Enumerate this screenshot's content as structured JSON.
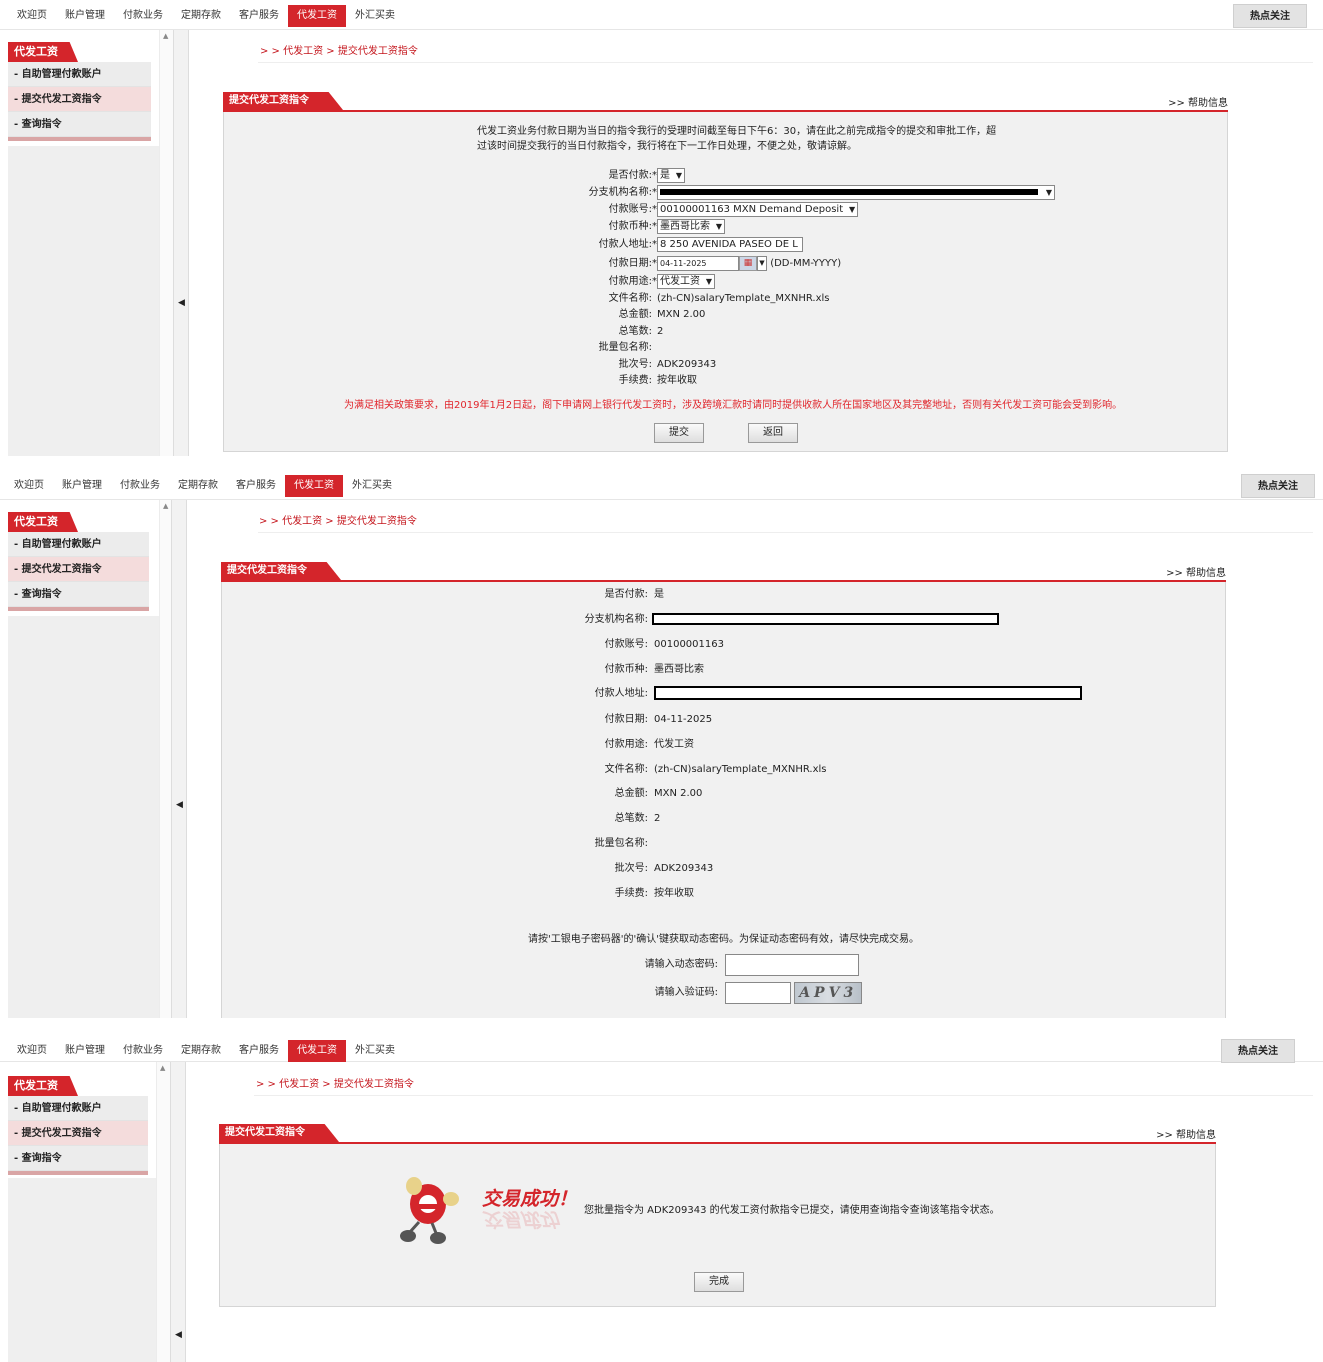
{
  "nav": {
    "items": [
      "欢迎页",
      "账户管理",
      "付款业务",
      "定期存款",
      "客户服务",
      "代发工资",
      "外汇买卖"
    ],
    "hot": "热点关注"
  },
  "sidebar": {
    "title": "代发工资",
    "items": [
      "- 自助管理付款账户",
      "- 提交代发工资指令",
      "- 查询指令"
    ]
  },
  "breadcrumb": "> > 代发工资 > 提交代发工资指令",
  "panel": {
    "title": "提交代发工资指令",
    "help": ">> 帮助信息"
  },
  "step1": {
    "notice": "代发工资业务付款日期为当日的指令我行的受理时间截至每日下午6：30，请在此之前完成指令的提交和审批工作，超过该时间提交我行的当日付款指令，我行将在下一工作日处理，不便之处，敬请谅解。",
    "required_mark": "*",
    "labels": {
      "is_payment": "是否付款:",
      "branch": "分支机构名称:",
      "account": "付款账号:",
      "currency": "付款币种:",
      "address": "付款人地址:",
      "date": "付款日期:",
      "purpose": "付款用途:",
      "filename": "文件名称:",
      "total": "总金额:",
      "count": "总笔数:",
      "batch_name": "批量包名称:",
      "batch_no": "批次号:",
      "fee": "手续费:"
    },
    "values": {
      "is_payment": "是",
      "account": "00100001163 MXN Demand Deposit",
      "currency": "墨西哥比索",
      "address": "8 250 AVENIDA PASEO DE L",
      "date": "04-11-2025",
      "date_format": "(DD-MM-YYYY)",
      "purpose": "代发工资",
      "filename": "(zh-CN)salaryTemplate_MXNHR.xls",
      "total": "MXN 2.00",
      "count": "2",
      "batch_name": "",
      "batch_no": "ADK209343",
      "fee": "按年收取"
    },
    "policy": "为满足相关政策要求，由2019年1月2日起，阁下申请网上银行代发工资时，涉及跨境汇款时请同时提供收款人所在国家地区及其完整地址，否则有关代发工资可能会受到影响。",
    "submit": "提交",
    "back": "返回"
  },
  "step2": {
    "labels": {
      "is_payment": "是否付款:",
      "branch": "分支机构名称:",
      "account": "付款账号:",
      "currency": "付款币种:",
      "address": "付款人地址:",
      "date": "付款日期:",
      "purpose": "付款用途:",
      "filename": "文件名称:",
      "total": "总金额:",
      "count": "总笔数:",
      "batch_name": "批量包名称:",
      "batch_no": "批次号:",
      "fee": "手续费:"
    },
    "values": {
      "is_payment": "是",
      "account": "00100001163",
      "currency": "墨西哥比索",
      "date": "04-11-2025",
      "purpose": "代发工资",
      "filename": "(zh-CN)salaryTemplate_MXNHR.xls",
      "total": "MXN 2.00",
      "count": "2",
      "batch_name": "",
      "batch_no": "ADK209343",
      "fee": "按年收取"
    },
    "token_notice": "请按'工银电子密码器'的'确认'键获取动态密码。为保证动态密码有效，请尽快完成交易。",
    "otp_label": "请输入动态密码:",
    "captcha_label": "请输入验证码:",
    "captcha_text": "APV3"
  },
  "step3": {
    "success_title": "交易成功！",
    "message": "您批量指令为 ADK209343 的代发工资付款指令已提交，请使用查询指令查询该笔指令状态。",
    "done": "完成"
  },
  "colors": {
    "accent": "#d4252b",
    "panel_bg": "#f1f1f1",
    "policy_text": "#e1262c"
  }
}
